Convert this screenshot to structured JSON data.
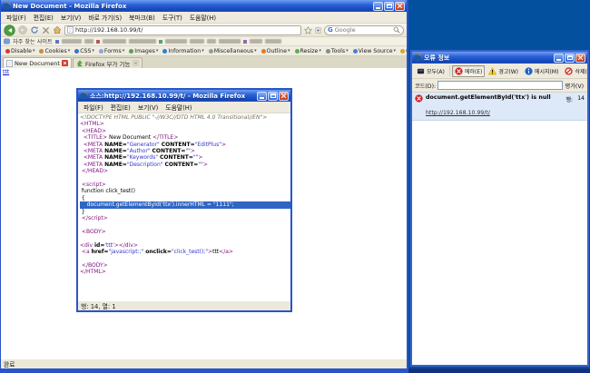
{
  "desktop": {
    "background": "#02509e"
  },
  "main_window": {
    "title": "New Document - Mozilla Firefox",
    "menu_items": [
      "파일(F)",
      "편집(E)",
      "보기(V)",
      "바로 가기(S)",
      "북마크(B)",
      "도구(T)",
      "도움말(H)"
    ],
    "nav": {
      "url": "http://192.168.10.99/t/",
      "search_placeholder": "Google"
    },
    "bookmarks_bar": {
      "label": "자주 찾는 사이트"
    },
    "webdev_items": [
      {
        "label": "Disable",
        "icon": "disable-icon"
      },
      {
        "label": "Cookies",
        "icon": "cookies-icon"
      },
      {
        "label": "CSS",
        "icon": "css-icon"
      },
      {
        "label": "Forms",
        "icon": "forms-icon"
      },
      {
        "label": "Images",
        "icon": "images-icon"
      },
      {
        "label": "Information",
        "icon": "information-icon"
      },
      {
        "label": "Miscellaneous",
        "icon": "miscellaneous-icon"
      },
      {
        "label": "Outline",
        "icon": "outline-icon"
      },
      {
        "label": "Resize",
        "icon": "resize-icon"
      },
      {
        "label": "Tools",
        "icon": "tools-icon"
      },
      {
        "label": "View Source",
        "icon": "view-source-icon"
      },
      {
        "label": "Options",
        "icon": "options-icon"
      }
    ],
    "tabs": [
      {
        "label": "New Document",
        "icon": "page-icon",
        "active": true
      },
      {
        "label": "Firefox 부가 기능",
        "icon": "addon-icon",
        "active": false
      }
    ],
    "page_link": "ttt",
    "status": "완료"
  },
  "source_window": {
    "title": "소스:http://192.168.10.99/t/ - Mozilla Firefox",
    "menu_items": [
      "파일(F)",
      "편집(E)",
      "보기(V)",
      "도움말(H)"
    ],
    "status": "행: 14, 열: 1",
    "code_lines": [
      {
        "tokens": [
          [
            "d",
            "<!DOCTYPE HTML PUBLIC \"-//W3C//DTD HTML 4.0 Transitional//EN\">"
          ]
        ]
      },
      {
        "tokens": [
          [
            "t",
            "<HTML>"
          ]
        ]
      },
      {
        "tokens": [
          [
            "p",
            " "
          ],
          [
            "t",
            "<HEAD>"
          ]
        ]
      },
      {
        "tokens": [
          [
            "p",
            "  "
          ],
          [
            "t",
            "<TITLE>"
          ],
          [
            "p",
            " New Document "
          ],
          [
            "t",
            "</TITLE>"
          ]
        ]
      },
      {
        "tokens": [
          [
            "p",
            "  "
          ],
          [
            "t",
            "<META"
          ],
          [
            "p",
            " "
          ],
          [
            "a",
            "NAME="
          ],
          [
            "v",
            "\"Generator\""
          ],
          [
            "p",
            " "
          ],
          [
            "a",
            "CONTENT="
          ],
          [
            "v",
            "\"EditPlus\""
          ],
          [
            "t",
            ">"
          ]
        ]
      },
      {
        "tokens": [
          [
            "p",
            "  "
          ],
          [
            "t",
            "<META"
          ],
          [
            "p",
            " "
          ],
          [
            "a",
            "NAME="
          ],
          [
            "v",
            "\"Author\""
          ],
          [
            "p",
            " "
          ],
          [
            "a",
            "CONTENT="
          ],
          [
            "v",
            "\"\""
          ],
          [
            "t",
            ">"
          ]
        ]
      },
      {
        "tokens": [
          [
            "p",
            "  "
          ],
          [
            "t",
            "<META"
          ],
          [
            "p",
            " "
          ],
          [
            "a",
            "NAME="
          ],
          [
            "v",
            "\"Keywords\""
          ],
          [
            "p",
            " "
          ],
          [
            "a",
            "CONTENT="
          ],
          [
            "v",
            "\"\""
          ],
          [
            "t",
            ">"
          ]
        ]
      },
      {
        "tokens": [
          [
            "p",
            "  "
          ],
          [
            "t",
            "<META"
          ],
          [
            "p",
            " "
          ],
          [
            "a",
            "NAME="
          ],
          [
            "v",
            "\"Description\""
          ],
          [
            "p",
            " "
          ],
          [
            "a",
            "CONTENT="
          ],
          [
            "v",
            "\"\""
          ],
          [
            "t",
            ">"
          ]
        ]
      },
      {
        "tokens": [
          [
            "p",
            " "
          ],
          [
            "t",
            "</HEAD>"
          ]
        ]
      },
      {
        "tokens": []
      },
      {
        "tokens": [
          [
            "p",
            " "
          ],
          [
            "t",
            "<script>"
          ]
        ]
      },
      {
        "tokens": [
          [
            "p",
            " function click_test()"
          ]
        ]
      },
      {
        "tokens": [
          [
            "p",
            " {"
          ]
        ]
      },
      {
        "hl": true,
        "tokens": [
          [
            "p",
            "    document.getElementById('ttx').innerHTML = \"1111\";"
          ]
        ]
      },
      {
        "tokens": [
          [
            "p",
            " }"
          ]
        ]
      },
      {
        "tokens": [
          [
            "p",
            " "
          ],
          [
            "t",
            "</script>"
          ]
        ]
      },
      {
        "tokens": []
      },
      {
        "tokens": [
          [
            "p",
            " "
          ],
          [
            "t",
            "<BODY>"
          ]
        ]
      },
      {
        "tokens": []
      },
      {
        "tokens": [
          [
            "t",
            "<div"
          ],
          [
            "p",
            " "
          ],
          [
            "a",
            "id="
          ],
          [
            "v",
            "'ttt'"
          ],
          [
            "t",
            "></div>"
          ]
        ]
      },
      {
        "tokens": [
          [
            "p",
            " "
          ],
          [
            "t",
            "<a"
          ],
          [
            "p",
            " "
          ],
          [
            "a",
            "href="
          ],
          [
            "v",
            "\"javascript:;\""
          ],
          [
            "p",
            " "
          ],
          [
            "a",
            "onclick="
          ],
          [
            "v",
            "\"click_test();\""
          ],
          [
            "t",
            ">"
          ],
          [
            "p",
            "ttt"
          ],
          [
            "t",
            "</a>"
          ]
        ]
      },
      {
        "tokens": []
      },
      {
        "tokens": [
          [
            "p",
            " "
          ],
          [
            "t",
            "</BODY>"
          ]
        ]
      },
      {
        "tokens": [
          [
            "t",
            "</HTML>"
          ]
        ]
      }
    ]
  },
  "error_console": {
    "title": "오류 정보",
    "filter_buttons": [
      {
        "label": "모두(A)",
        "icon": "console-icon",
        "active": false
      },
      {
        "label": "에러(E)",
        "icon": "error-icon",
        "active": true
      },
      {
        "label": "경고(W)",
        "icon": "warning-icon",
        "active": false
      },
      {
        "label": "메시지(M)",
        "icon": "message-icon",
        "active": false
      },
      {
        "label": "삭제(C)",
        "icon": "clear-icon",
        "active": false
      }
    ],
    "code_label": "코드(D):",
    "code_value": "",
    "evaluate_label": "평가(V)",
    "entries": [
      {
        "severity": "error",
        "message": "document.getElementById('ttx') is null",
        "source": "http://192.168.10.99/t/",
        "line_label": "행:",
        "line_number": "14"
      }
    ]
  },
  "colors": {
    "desktop": "#02509e",
    "titlebar_blue": "#2b62da",
    "chrome_beige": "#ece9d8",
    "selection_blue": "#2f66c4",
    "code_tag": "#7d0f7d",
    "code_value": "#3434c8",
    "code_doctype": "#70705c",
    "error_red": "#cf2020",
    "entry_bg": "#dde9f8"
  }
}
